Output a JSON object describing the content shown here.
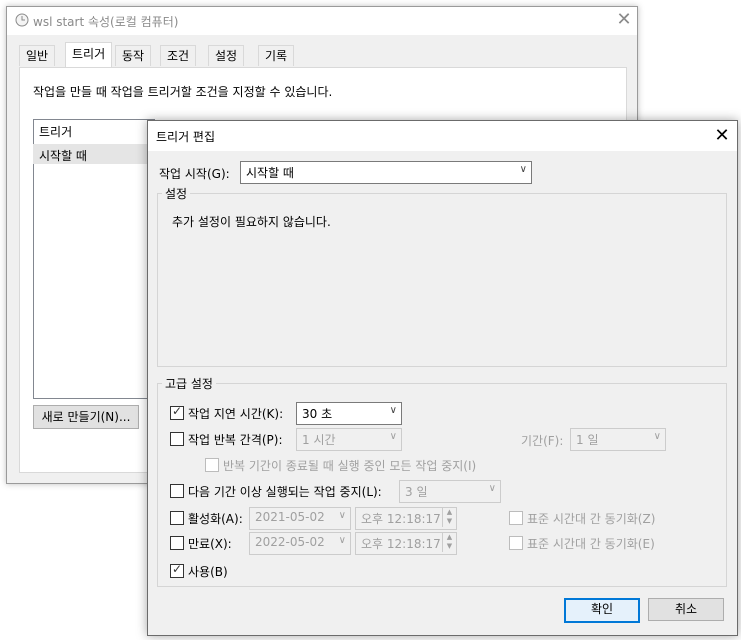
{
  "background_window": {
    "title": "wsl start 속성(로컬 컴퓨터)",
    "tabs": [
      "일반",
      "트리거",
      "동작",
      "조건",
      "설정",
      "기록"
    ],
    "description": "작업을 만들 때 작업을 트리거할 조건을 지정할 수 있습니다.",
    "list_header": "트리거",
    "list_item": "시작할 때",
    "new_button": "새로 만들기(N)..."
  },
  "dialog": {
    "title": "트리거 편집",
    "begin_label": "작업 시작(G):",
    "begin_value": "시작할 때",
    "settings_group": "설정",
    "settings_text": "추가 설정이 필요하지 않습니다.",
    "advanced_group": "고급 설정",
    "delay_label": "작업 지연 시간(K):",
    "delay_value": "30 초",
    "repeat_label": "작업 반복 간격(P):",
    "repeat_value": "1 시간",
    "duration_label": "기간(F):",
    "duration_value": "1 일",
    "stop_repeat_label": "반복 기간이 종료될 때 실행 중인 모든 작업 중지(I)",
    "stop_longer_label": "다음 기간 이상 실행되는 작업 중지(L):",
    "stop_longer_value": "3 일",
    "activate_label": "활성화(A):",
    "activate_date": "2021-05-02",
    "activate_time": "오후 12:18:17",
    "activate_sync": "표준 시간대 간 동기화(Z)",
    "expire_label": "만료(X):",
    "expire_date": "2022-05-02",
    "expire_time": "오후 12:18:17",
    "expire_sync": "표준 시간대 간 동기화(E)",
    "enabled_label": "사용(B)",
    "ok": "확인",
    "cancel": "취소"
  },
  "state": {
    "delay_checked": true,
    "repeat_checked": false,
    "stop_repeat_checked": false,
    "stop_longer_checked": false,
    "activate_checked": false,
    "expire_checked": false,
    "enabled_checked": true
  }
}
